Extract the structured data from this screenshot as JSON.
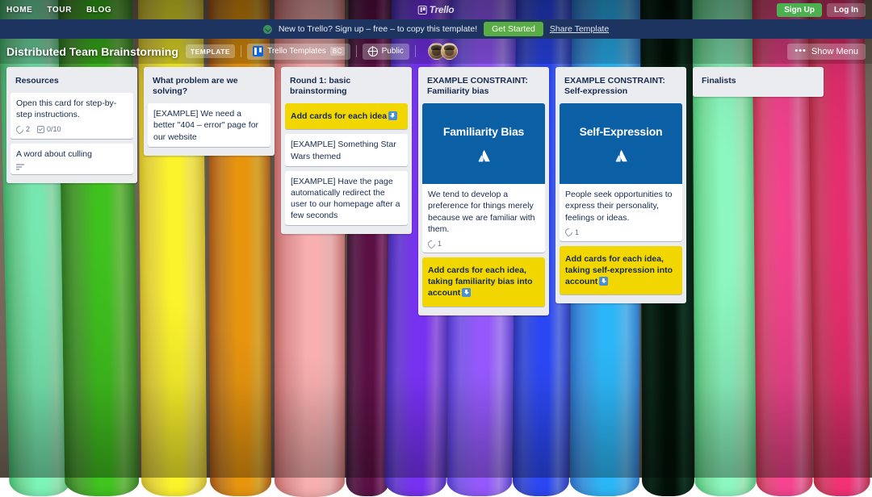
{
  "top_nav": {
    "links": [
      "HOME",
      "TOUR",
      "BLOG"
    ],
    "brand": "Trello",
    "sign_up": "Sign Up",
    "log_in": "Log In"
  },
  "template_banner": {
    "icon": "trello-circle-icon",
    "text": "New to Trello? Sign up – free – to copy this template!",
    "cta": "Get Started",
    "share": "Share Template",
    "bg_color": "#1d3461",
    "cta_color": "#5aac44"
  },
  "board_header": {
    "title": "Distributed Team Brainstorming",
    "template_badge": "TEMPLATE",
    "workspace": "Trello Templates",
    "workspace_initials": "BC",
    "visibility": "Public",
    "show_menu": "Show Menu",
    "menu_dots": "•••",
    "members": [
      "member-avatar-1",
      "member-avatar-2"
    ]
  },
  "lists": [
    {
      "title": "Resources",
      "cards": [
        {
          "title": "Open this card for step-by-step instructions.",
          "style": "white",
          "badges": [
            {
              "icon": "attachment-icon",
              "text": "2"
            },
            {
              "icon": "checklist-icon",
              "text": "0/10"
            }
          ]
        },
        {
          "title": "A word about culling",
          "style": "white",
          "badges": [
            {
              "icon": "description-icon",
              "text": ""
            }
          ]
        }
      ]
    },
    {
      "title": "What problem are we solving?",
      "cards": [
        {
          "title": "[EXAMPLE] We need a better \"404 – error\" page for our website",
          "style": "white",
          "badges": []
        }
      ]
    },
    {
      "title": "Round 1: basic brainstorming",
      "cards": [
        {
          "title": "Add cards for each idea",
          "style": "yellow",
          "trailing_emoji": "down-arrow-emoji",
          "badges": []
        },
        {
          "title": "[EXAMPLE] Something Star Wars themed",
          "style": "white",
          "badges": []
        },
        {
          "title": "[EXAMPLE] Have the page automatically redirect the user to our homepage after a few seconds",
          "style": "white",
          "badges": []
        }
      ]
    },
    {
      "title": "EXAMPLE CONSTRAINT: Familiarity bias",
      "cards": [
        {
          "style": "cover",
          "cover_title": "Familiarity Bias",
          "cover_color": "#0b5fa5",
          "cover_logo": "atlassian-logo-icon",
          "title": "We tend to develop a preference for things merely because we are familiar with them.",
          "badges": [
            {
              "icon": "attachment-icon",
              "text": "1"
            }
          ]
        },
        {
          "title": "Add cards for each idea, taking familiarity bias into account",
          "style": "yellow",
          "trailing_emoji": "down-arrow-emoji",
          "badges": []
        }
      ]
    },
    {
      "title": "EXAMPLE CONSTRAINT: Self-expression",
      "cards": [
        {
          "style": "cover",
          "cover_title": "Self-Expression",
          "cover_color": "#0b5fa5",
          "cover_logo": "atlassian-logo-icon",
          "title": "People seek opportunities to express their personality, feelings or ideas.",
          "badges": [
            {
              "icon": "attachment-icon",
              "text": "1"
            }
          ]
        },
        {
          "title": "Add cards for each idea, taking self-expression into account",
          "style": "yellow",
          "trailing_emoji": "down-arrow-emoji",
          "badges": []
        }
      ]
    },
    {
      "title": "Finalists",
      "cards": []
    }
  ],
  "background": {
    "description": "colorful chalk pastel sticks photo",
    "chalk_colors": [
      "#7ed9a0",
      "#5aa83e",
      "#e8d84a",
      "#c98b2a",
      "#e09a9a",
      "#6b2d5c",
      "#7b4fd4",
      "#8a6ae8",
      "#4a5fd8",
      "#4a9fe0",
      "#0f2d1e",
      "#86e0a6",
      "#e05d88",
      "#d94f7a"
    ]
  }
}
